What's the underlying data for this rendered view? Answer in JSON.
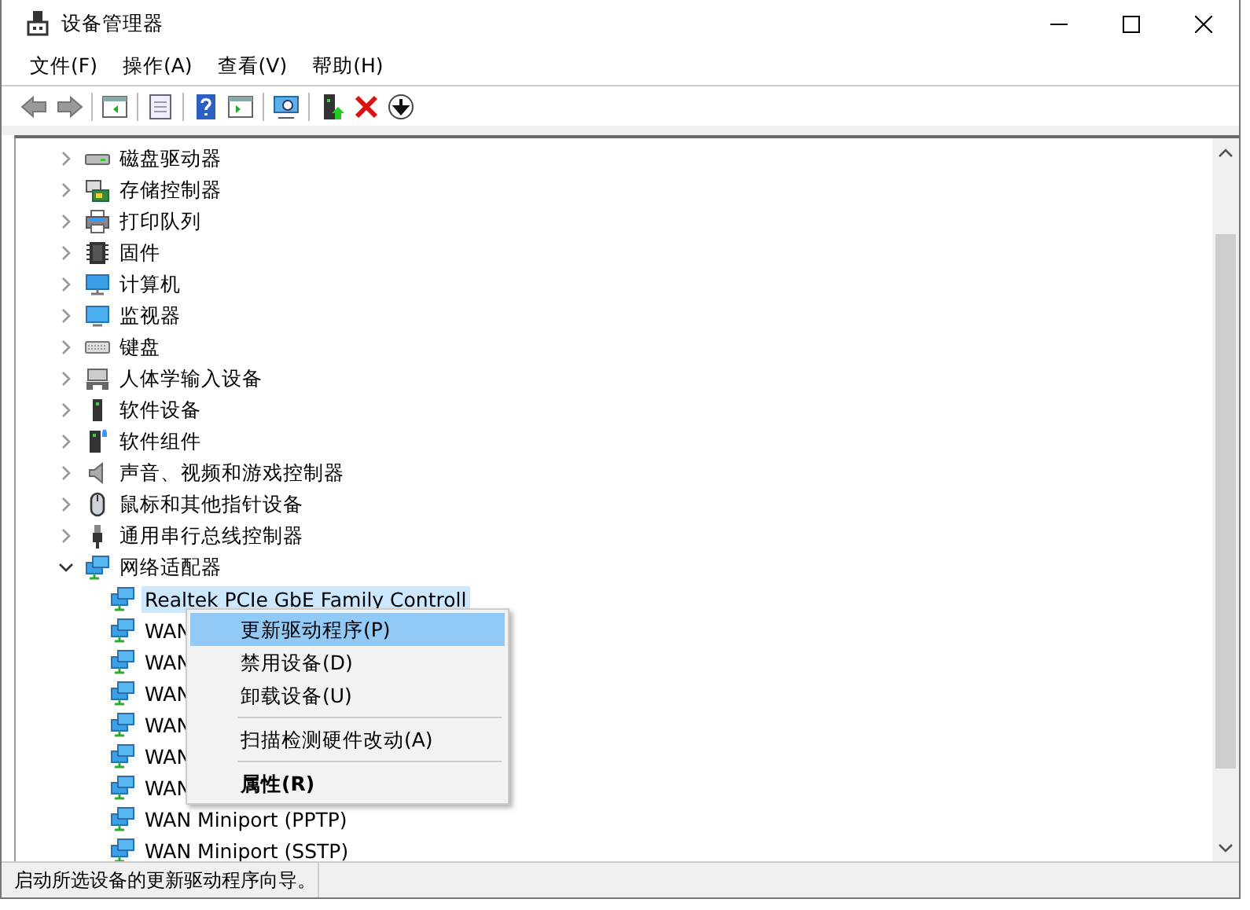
{
  "window": {
    "title": "设备管理器"
  },
  "menu_bar": [
    {
      "label": "文件(F)"
    },
    {
      "label": "操作(A)"
    },
    {
      "label": "查看(V)"
    },
    {
      "label": "帮助(H)"
    }
  ],
  "tree": {
    "items": [
      {
        "label": "磁盘驱动器",
        "expanded": false
      },
      {
        "label": "存储控制器",
        "expanded": false
      },
      {
        "label": "打印队列",
        "expanded": false
      },
      {
        "label": "固件",
        "expanded": false
      },
      {
        "label": "计算机",
        "expanded": false
      },
      {
        "label": "监视器",
        "expanded": false
      },
      {
        "label": "键盘",
        "expanded": false
      },
      {
        "label": "人体学输入设备",
        "expanded": false
      },
      {
        "label": "软件设备",
        "expanded": false
      },
      {
        "label": "软件组件",
        "expanded": false
      },
      {
        "label": "声音、视频和游戏控制器",
        "expanded": false
      },
      {
        "label": "鼠标和其他指针设备",
        "expanded": false
      },
      {
        "label": "通用串行总线控制器",
        "expanded": false
      },
      {
        "label": "网络适配器",
        "expanded": true,
        "children": [
          {
            "label": "Realtek PCIe GbE Family Controll",
            "selected": true
          },
          {
            "label": "WAN",
            "selected": false
          },
          {
            "label": "WAN",
            "selected": false
          },
          {
            "label": "WAN",
            "selected": false
          },
          {
            "label": "WAN",
            "selected": false
          },
          {
            "label": "WAN",
            "selected": false
          },
          {
            "label": "WAN",
            "selected": false
          },
          {
            "label": "WAN Miniport (PPTP)",
            "selected": false
          },
          {
            "label": "WAN Miniport (SSTP)",
            "selected": false
          }
        ]
      }
    ]
  },
  "context_menu": {
    "items": [
      {
        "kind": "item",
        "label": "更新驱动程序(P)",
        "selected": true,
        "default": false
      },
      {
        "kind": "item",
        "label": "禁用设备(D)",
        "selected": false,
        "default": false
      },
      {
        "kind": "item",
        "label": "卸载设备(U)",
        "selected": false,
        "default": false
      },
      {
        "kind": "separator"
      },
      {
        "kind": "item",
        "label": "扫描检测硬件改动(A)",
        "selected": false,
        "default": false
      },
      {
        "kind": "separator"
      },
      {
        "kind": "item",
        "label": "属性(R)",
        "selected": false,
        "default": true
      }
    ]
  },
  "status_bar": {
    "text": "启动所选设备的更新驱动程序向导。"
  }
}
